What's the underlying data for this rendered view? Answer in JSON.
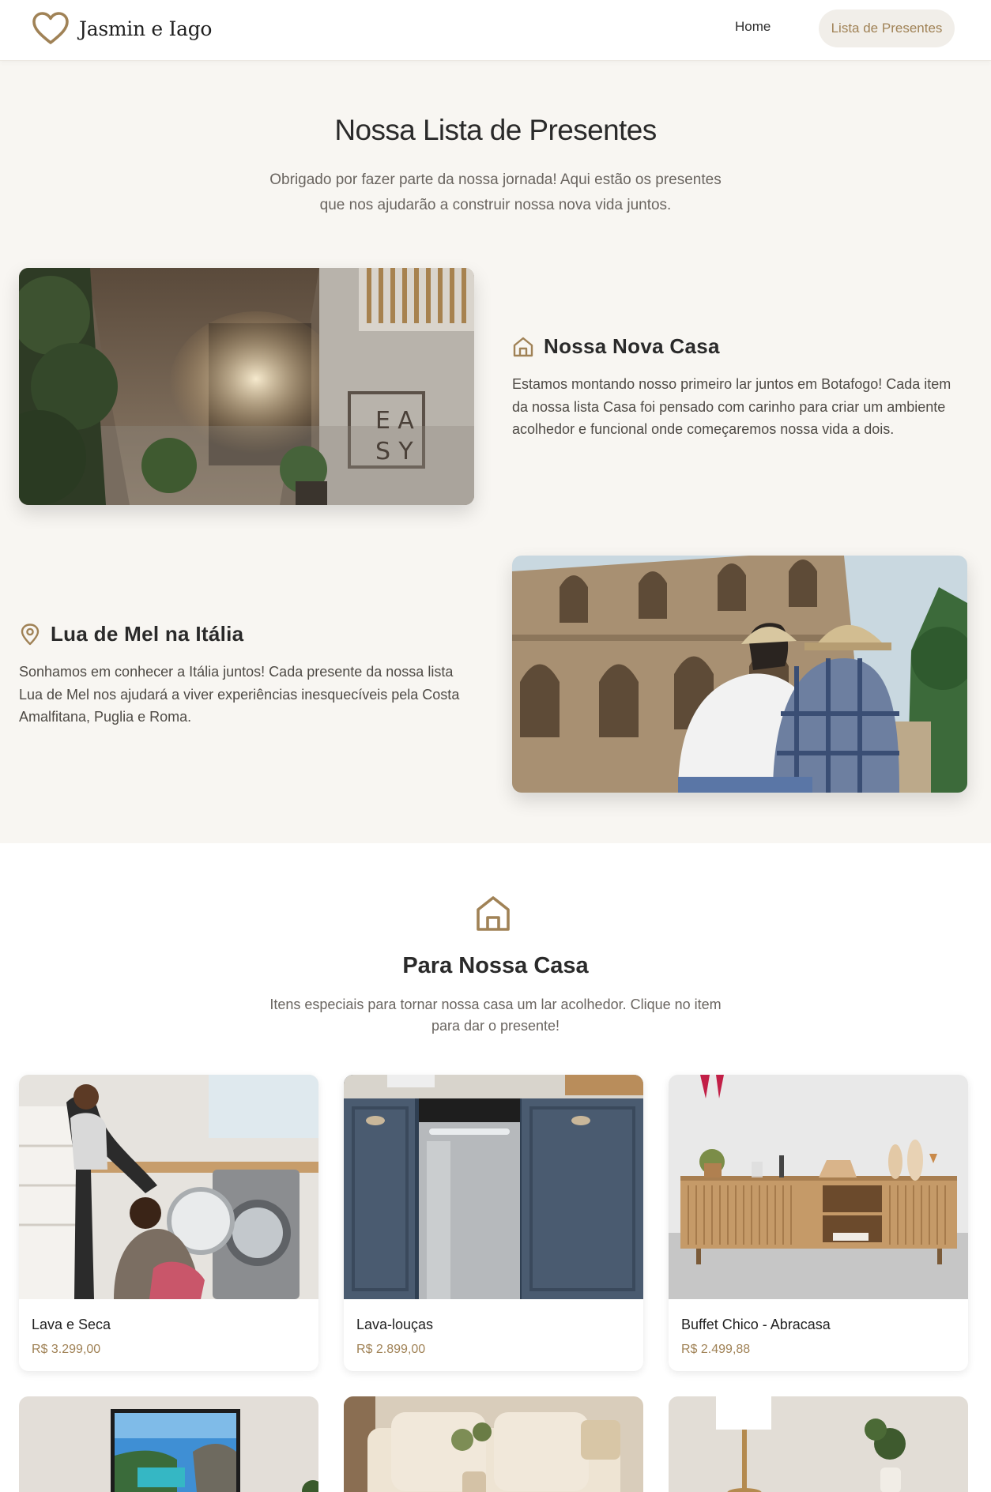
{
  "header": {
    "brand": "Jasmin e Iago",
    "logo_icon": "heart-outline-icon",
    "nav": {
      "home": "Home",
      "gifts": "Lista de Presentes"
    }
  },
  "hero": {
    "title": "Nossa Lista de Presentes",
    "subtitle": "Obrigado por fazer parte da nossa jornada! Aqui estão os presentes que nos ajudarão a construir nossa nova vida juntos."
  },
  "features": [
    {
      "icon": "home-icon",
      "title": "Nossa Nova Casa",
      "text": "Estamos montando nosso primeiro lar juntos em Botafogo! Cada item da nossa lista Casa foi pensado com carinho para criar um ambiente acolhedor e funcional onde começaremos nossa vida a dois.",
      "image_sign": [
        "E",
        "A",
        "S",
        "Y"
      ]
    },
    {
      "icon": "map-pin-icon",
      "title": "Lua de Mel na Itália",
      "text": "Sonhamos em conhecer a Itália juntos! Cada presente da nossa lista Lua de Mel nos ajudará a viver experiências inesquecíveis pela Costa Amalfitana, Puglia e Roma."
    }
  ],
  "casa_section": {
    "icon": "home-icon",
    "title": "Para Nossa Casa",
    "subtitle": "Itens especiais para tornar nossa casa um lar acolhedor. Clique no item para dar o presente!"
  },
  "gifts": [
    {
      "name": "Lava e Seca",
      "price": "R$ 3.299,00"
    },
    {
      "name": "Lava-louças",
      "price": "R$ 2.899,00"
    },
    {
      "name": "Buffet Chico - Abracasa",
      "price": "R$ 2.499,88"
    }
  ],
  "colors": {
    "accent": "#a08256",
    "hero_bg": "#f8f6f2",
    "text": "#2a2a2a"
  }
}
